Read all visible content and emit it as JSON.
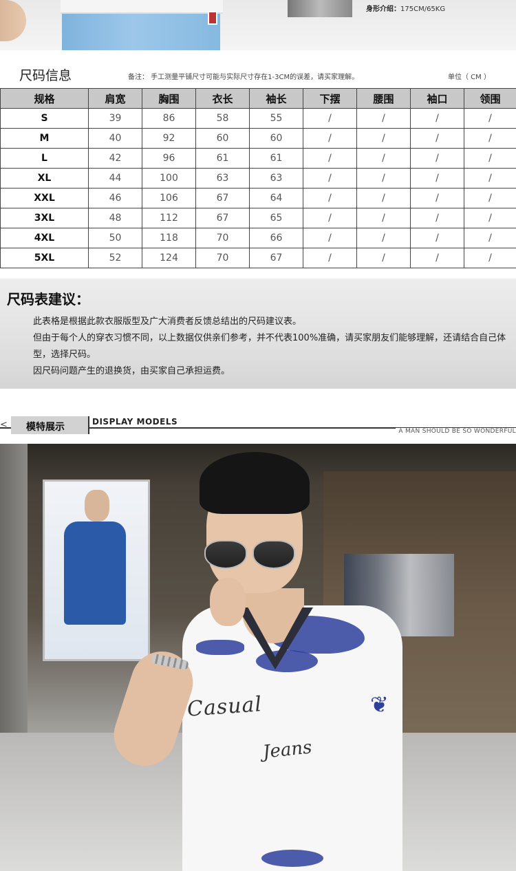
{
  "top": {
    "body_info_label": "身形介绍：",
    "body_info_value": "175CM/65KG"
  },
  "size_info": {
    "title": "尺码信息",
    "note": "备注： 手工测量平铺尺寸可能与实际尺寸存在1-3CM的误差，请买家理解。",
    "unit": "单位（ CM ）"
  },
  "table": {
    "headers": [
      "规格",
      "肩宽",
      "胸围",
      "衣长",
      "袖长",
      "下摆",
      "腰围",
      "袖口",
      "领围"
    ],
    "rows": [
      [
        "S",
        "39",
        "86",
        "58",
        "55",
        "/",
        "/",
        "/",
        "/"
      ],
      [
        "M",
        "40",
        "92",
        "60",
        "60",
        "/",
        "/",
        "/",
        "/"
      ],
      [
        "L",
        "42",
        "96",
        "61",
        "61",
        "/",
        "/",
        "/",
        "/"
      ],
      [
        "XL",
        "44",
        "100",
        "63",
        "63",
        "/",
        "/",
        "/",
        "/"
      ],
      [
        "XXL",
        "46",
        "106",
        "67",
        "64",
        "/",
        "/",
        "/",
        "/"
      ],
      [
        "3XL",
        "48",
        "112",
        "67",
        "65",
        "/",
        "/",
        "/",
        "/"
      ],
      [
        "4XL",
        "50",
        "118",
        "70",
        "66",
        "/",
        "/",
        "/",
        "/"
      ],
      [
        "5XL",
        "52",
        "124",
        "70",
        "67",
        "/",
        "/",
        "/",
        "/"
      ]
    ]
  },
  "suggestion": {
    "title": "尺码表建议：",
    "lines": [
      "此表格是根据此款衣服版型及广大消费者反馈总结出的尺码建议表。",
      "但由于每个人的穿衣习惯不同，以上数据仅供亲们参考，并不代表100%准确，请买家朋友们能够理解，还请结合自己体型，选择尺码。",
      "因尺码问题产生的退换货，由买家自己承担运费。"
    ]
  },
  "models": {
    "arrow": "<",
    "label": "模特展示",
    "en_label": "DISPLAY MODELS",
    "slogan": "A MAN SHOULD BE SO WONDERFUL"
  },
  "photo": {
    "print_line1": "Casual",
    "print_line2": "Jeans"
  }
}
